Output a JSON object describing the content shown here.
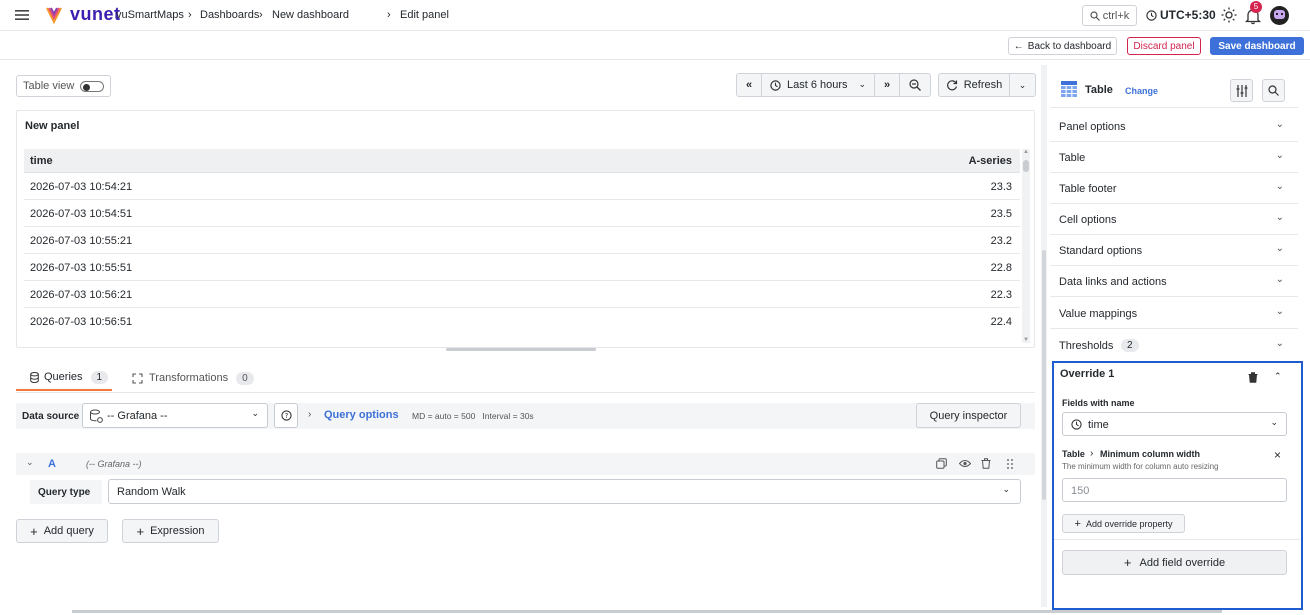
{
  "topbar": {
    "logo_text": "vunet",
    "breadcrumbs": [
      "vuSmartMaps",
      "Dashboards",
      "New dashboard",
      "Edit panel"
    ],
    "search_hint": "ctrl+k",
    "timezone": "UTC+5:30",
    "notification_count": "5"
  },
  "subbar": {
    "back_label": "Back to dashboard",
    "discard_label": "Discard panel",
    "save_label": "Save dashboard"
  },
  "toolbar": {
    "table_view_label": "Table view",
    "time_range": "Last 6 hours",
    "refresh_label": "Refresh"
  },
  "panel": {
    "title": "New panel",
    "columns": [
      "time",
      "A-series"
    ],
    "rows": [
      {
        "time": "2026-07-03 10:54:21",
        "value": "23.3"
      },
      {
        "time": "2026-07-03 10:54:51",
        "value": "23.5"
      },
      {
        "time": "2026-07-03 10:55:21",
        "value": "23.2"
      },
      {
        "time": "2026-07-03 10:55:51",
        "value": "22.8"
      },
      {
        "time": "2026-07-03 10:56:21",
        "value": "22.3"
      },
      {
        "time": "2026-07-03 10:56:51",
        "value": "22.4"
      }
    ]
  },
  "tabs": {
    "queries_label": "Queries",
    "queries_count": "1",
    "transformations_label": "Transformations",
    "transformations_count": "0"
  },
  "query": {
    "datasource_label": "Data source",
    "datasource_value": "-- Grafana --",
    "options_label": "Query options",
    "options_meta": "MD = auto = 500   Interval = 30s",
    "inspector_label": "Query inspector",
    "ref_id": "A",
    "ref_source": "(-- Grafana --)",
    "query_type_label": "Query type",
    "query_type_value": "Random Walk",
    "add_query_label": "Add query",
    "expression_label": "Expression"
  },
  "options_pane": {
    "viz_name": "Table",
    "change_label": "Change",
    "sections": [
      "Panel options",
      "Table",
      "Table footer",
      "Cell options",
      "Standard options",
      "Data links and actions",
      "Value mappings",
      "Thresholds"
    ],
    "thresholds_count": "2",
    "override": {
      "title": "Override 1",
      "matcher_label": "Fields with name",
      "matcher_value": "time",
      "property_path_a": "Table",
      "property_path_b": "Minimum column width",
      "property_desc": "The minimum width for column auto resizing",
      "property_placeholder": "150",
      "add_property_label": "Add override property",
      "add_field_override_label": "Add field override"
    }
  },
  "colors": {
    "accent": "#3d71d9",
    "discard": "#d4254e",
    "highlight_border": "#1f5bd1"
  }
}
